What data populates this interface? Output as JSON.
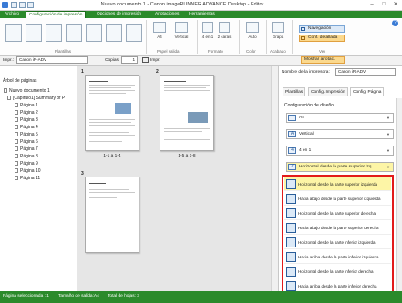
{
  "window": {
    "title": "Nuevo documento 1 - Canon imageRUNNER ADVANCE Desktop - Editor",
    "minimize": "–",
    "maximize": "□",
    "close": "✕"
  },
  "tabs": [
    "Archivo",
    "Configuración de impresión",
    "Opciones de impresión",
    "Anotaciones",
    "Herramientas"
  ],
  "ribbon": {
    "groups": {
      "plantillas": "Plantillas",
      "papel": "Papel salida",
      "formato": "Formato",
      "color": "Color",
      "acabado": "Acabado",
      "ver": "Ver"
    },
    "a4_label": "A4",
    "vertical_label": "Vertical",
    "paginas_label": "4 en 1",
    "caras_label": "2 caras",
    "color_label": "Auto",
    "grapa_label": "Grapa",
    "navegacion": "Navegación",
    "conf_detallada": "Conf. detallada",
    "mostrar_anotac": "Mostrar anotac."
  },
  "optbar": {
    "impr_label": "Impr.:",
    "printer": "Canon iR-ADV",
    "copias_label": "Copias:",
    "copias_value": "1",
    "impr_btn": "Impr."
  },
  "tree": {
    "title": "Árbol de páginas",
    "document": "Nuevo documento 1",
    "chapter": "[Capítulo1] Summary of P",
    "pages": [
      "Página 1",
      "Página 2",
      "Página 3",
      "Página 4",
      "Página 5",
      "Página 6",
      "Página 7",
      "Página 8",
      "Página 9",
      "Página 10",
      "Página 11"
    ]
  },
  "preview": {
    "sheets": [
      {
        "number": "1",
        "caption": "1-1 a 1-4"
      },
      {
        "number": "2",
        "caption": "1-5 a 1-8"
      },
      {
        "number": "3",
        "caption": ""
      }
    ]
  },
  "panel": {
    "printer_label": "Nombre de la impresora:",
    "printer_value": "Canon iR-ADV",
    "tabs": [
      "Plantillas",
      "Config. Impresión",
      "Config. Página"
    ],
    "section_title": "Configuración de diseño",
    "paper": "A4",
    "orientation": "Vertical",
    "layout": "4 en 1",
    "order_selected": "Horizontal desde la parte superior izq."
  },
  "order_options": [
    "Horizontal desde la parte superior izquierda",
    "Hacia abajo desde la parte superior izquierda",
    "Horizontal desde la parte superior derecha",
    "Hacia abajo desde la parte superior derecha",
    "Horizontal desde la parte inferior izquierda",
    "Hacia arriba desde la parte inferior izquierda",
    "Horizontal desde la parte inferior derecha",
    "Hacia arriba desde la parte inferior derecha"
  ],
  "status": {
    "selected": "Página seleccionada : 1",
    "size": "Tamaño de salida:A4",
    "sheets": "Total de hojas: 3"
  },
  "colors": {
    "accent_green": "#2b8a2b",
    "highlight_red": "#e21b1b",
    "selected_yellow": "#fdf5a6"
  }
}
